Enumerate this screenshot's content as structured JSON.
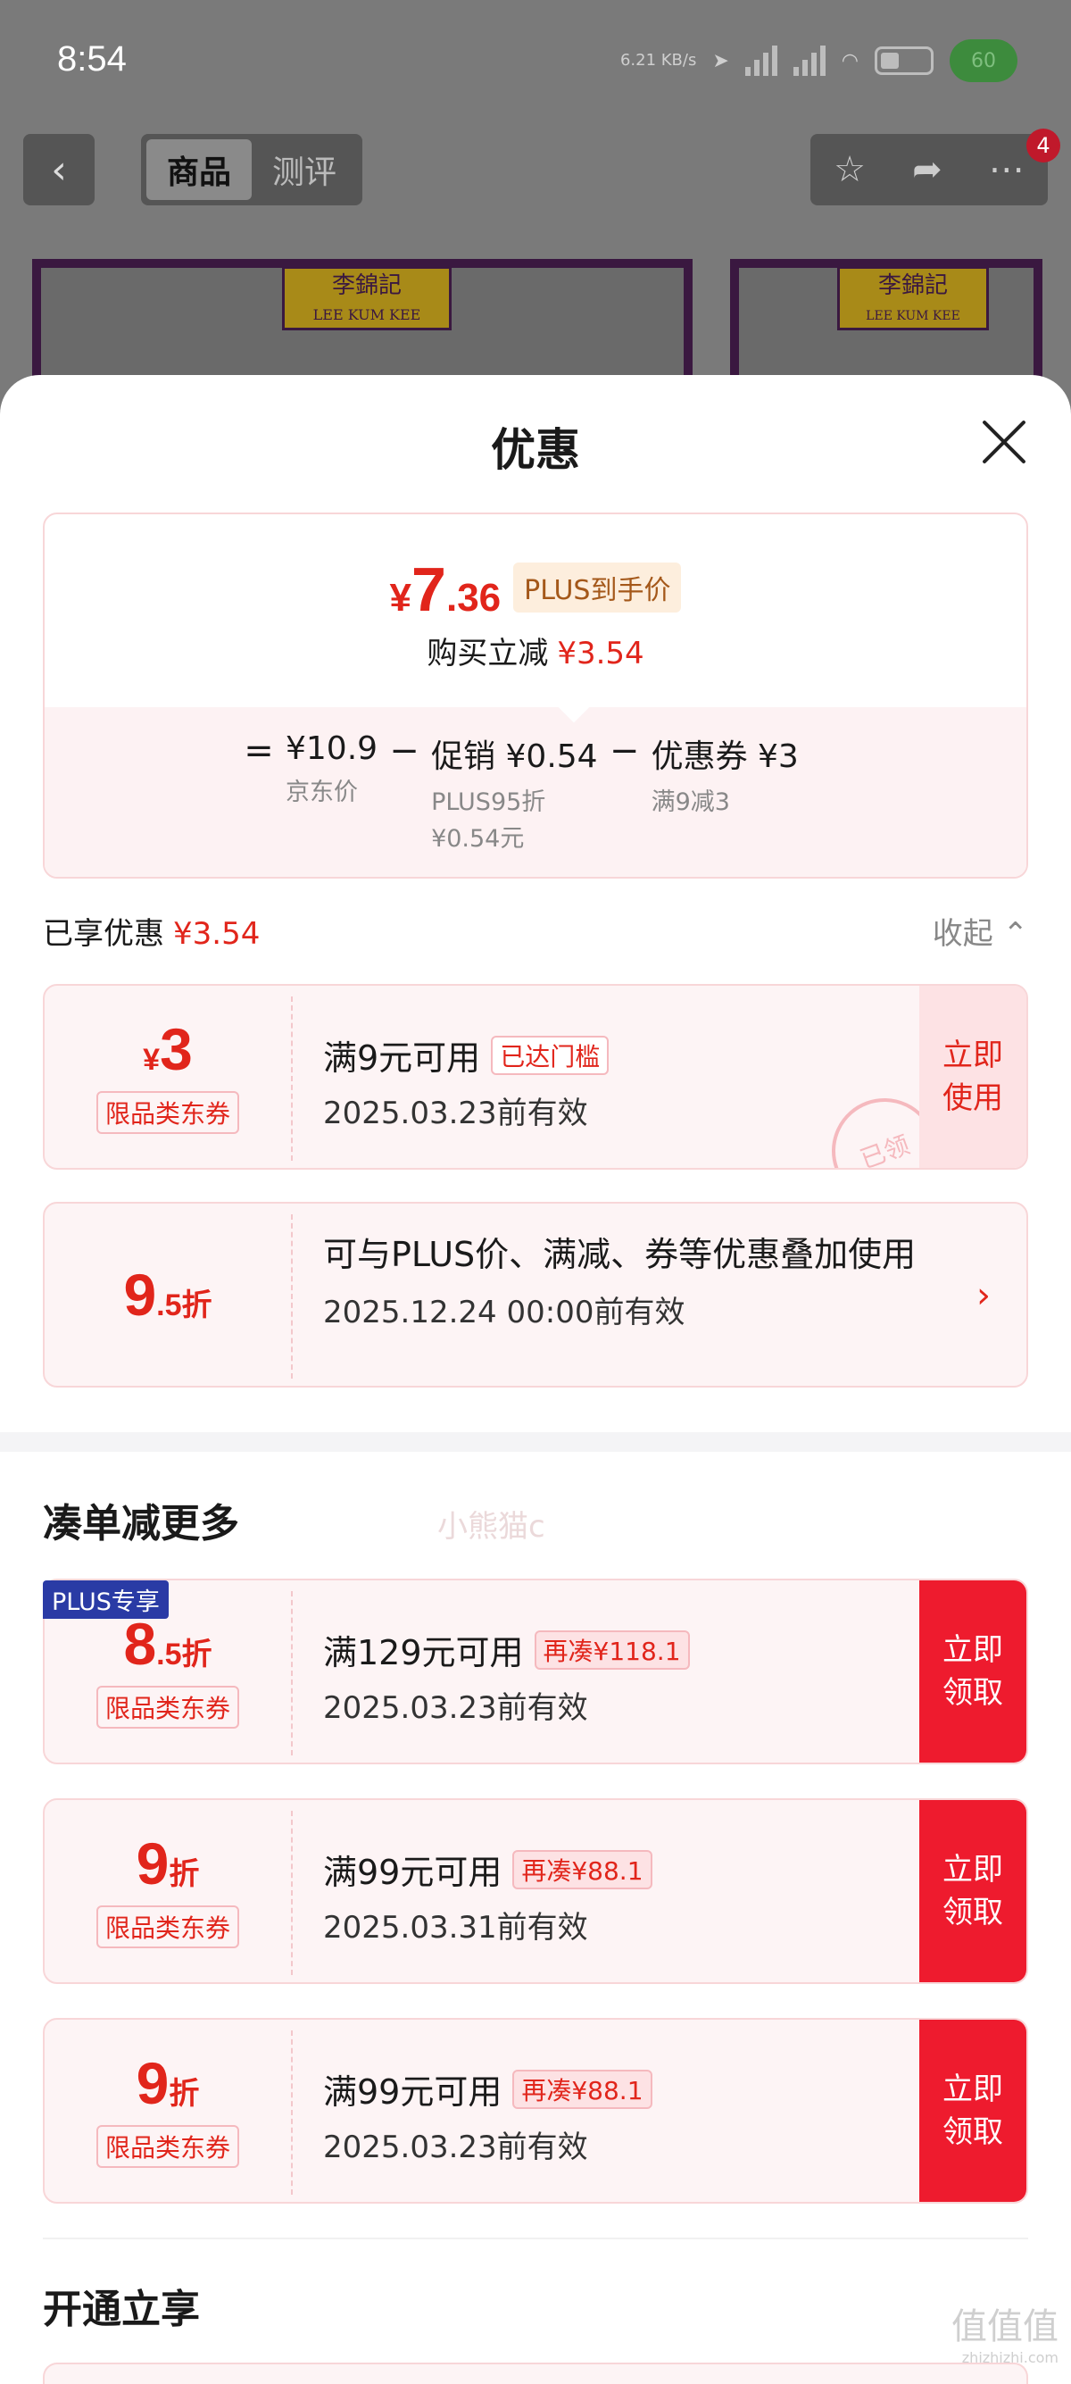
{
  "status_bar": {
    "time": "8:54",
    "net_speed": "6.21 KB/s",
    "battery_percent": "60"
  },
  "top_nav": {
    "back_icon": "chevron-left-icon",
    "tabs": [
      {
        "label": "商品",
        "active": true
      },
      {
        "label": "测评",
        "active": false
      }
    ],
    "more_badge": "4"
  },
  "banner": {
    "brand_cn": "李錦記",
    "brand_en": "LEE KUM KEE"
  },
  "sheet": {
    "title": "优惠",
    "price_summary": {
      "currency": "¥",
      "price_int": "7",
      "price_dec": ".36",
      "plus_tag": "PLUS到手价",
      "reduce_label": "购买立减",
      "reduce_value": "¥3.54",
      "equals": "=",
      "minus": "−",
      "base_price": "¥10.9",
      "base_label": "京东价",
      "promo": "促销 ¥0.54",
      "promo_sub1": "PLUS95折",
      "promo_sub2": "¥0.54元",
      "coupon": "优惠券 ¥3",
      "coupon_sub": "满9减3"
    },
    "enjoyed": {
      "label": "已享优惠",
      "value": "¥3.54",
      "collapse": "收起 ⌃"
    },
    "used_coupon": {
      "currency": "¥",
      "value": "3",
      "kind": "限品类东券",
      "condition": "满9元可用",
      "tag": "已达门槛",
      "date": "2025.03.23前有效",
      "action": "立即使用",
      "stamp": "已领",
      "watermark": "小熊猫c"
    },
    "plus_coupon": {
      "badge": "PLUS专享",
      "value": "9",
      "value_dec": ".5",
      "unit": "折",
      "desc": "可与PLUS价、满减、券等优惠叠加使用",
      "date": "2025.12.24 00:00前有效",
      "chevron": "›"
    },
    "more_title": "凑单减更多",
    "more_coupons": [
      {
        "value": "8",
        "value_dec": ".5",
        "unit": "折",
        "kind": "限品类东券",
        "condition": "满129元可用",
        "tag": "再凑¥118.1",
        "date": "2025.03.23前有效",
        "action": "立即领取"
      },
      {
        "value": "9",
        "value_dec": "",
        "unit": "折",
        "kind": "限品类东券",
        "condition": "满99元可用",
        "tag": "再凑¥88.1",
        "date": "2025.03.31前有效",
        "action": "立即领取"
      },
      {
        "value": "9",
        "value_dec": "",
        "unit": "折",
        "kind": "限品类东券",
        "condition": "满99元可用",
        "tag": "再凑¥88.1",
        "date": "2025.03.23前有效",
        "action": "立即领取"
      }
    ],
    "open_title": "开通立享"
  },
  "site_mark": "值值值",
  "site_mark_url": "zhizhizhi.com",
  "colors": {
    "accent_red": "#e1251b",
    "button_red": "#ee1b2e",
    "plus_blue": "#2a3ba5",
    "plus_gold": "#a4581a"
  }
}
